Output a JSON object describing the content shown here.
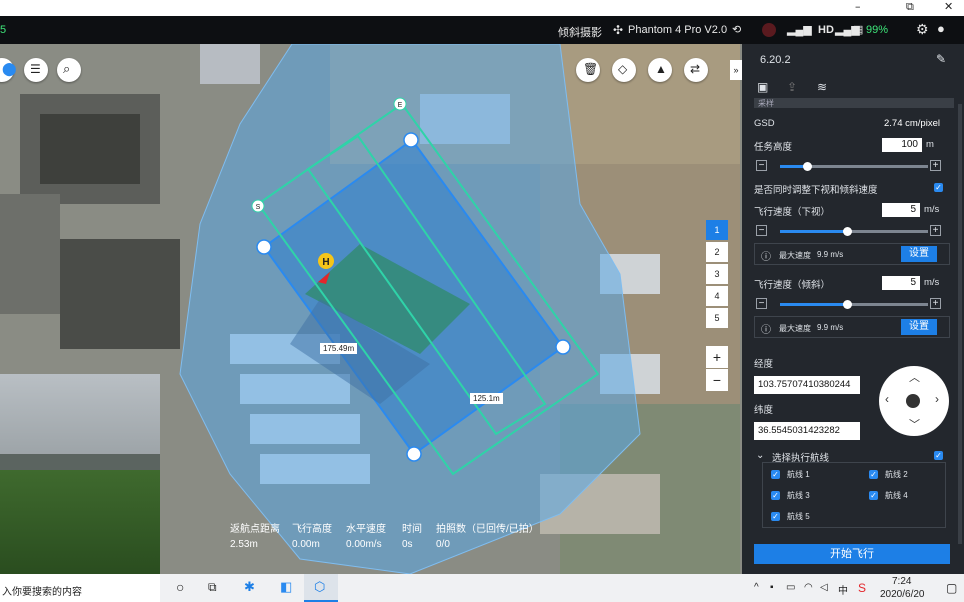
{
  "window": {
    "minimize": "–",
    "restore": "⧉",
    "close": "✕"
  },
  "status": {
    "left_mark": "5",
    "mode_label": "倾斜摄影",
    "drone_model": "Phantom 4 Pro V2.0",
    "hd_label": "HD",
    "battery": "99%"
  },
  "map": {
    "label_long": "175.49m",
    "label_short": "125.1m",
    "home_marker": "H",
    "start_marker": "S",
    "end_marker": "E",
    "route_tabs": [
      "1",
      "2",
      "3",
      "4",
      "5"
    ],
    "zoom_in": "+",
    "zoom_out": "−"
  },
  "telemetry": {
    "headers": [
      "返航点距离",
      "飞行高度",
      "水平速度",
      "时间",
      "拍照数（已回传/已拍）"
    ],
    "values": [
      "2.53m",
      "0.00m",
      "0.00m/s",
      "0s",
      "0/0"
    ]
  },
  "panel": {
    "version": "6.20.2",
    "partial_tab": "采样",
    "gsd_label": "GSD",
    "gsd_value": "2.74 cm/pixel",
    "altitude_label": "任务高度",
    "altitude_value": "100",
    "altitude_unit": "m",
    "altitude_level": 0.18,
    "simul_label": "是否同时调整下视和倾斜速度",
    "speed_down_label": "飞行速度（下视）",
    "speed_down_value": "5",
    "speed_unit": "m/s",
    "speed_down_level": 0.45,
    "max_speed_label": "最大速度",
    "max_speed_value": "9.9 m/s",
    "set_button": "设置",
    "speed_tilt_label": "飞行速度（倾斜）",
    "speed_tilt_value": "5",
    "speed_tilt_level": 0.45,
    "longitude_label": "经度",
    "longitude_value": "103.75707410380244",
    "latitude_label": "纬度",
    "latitude_value": "36.5545031423282",
    "select_routes_label": "选择执行航线",
    "routes": [
      "航线 1",
      "航线 2",
      "航线 3",
      "航线 4",
      "航线 5"
    ],
    "start_button": "开始飞行"
  },
  "taskbar": {
    "search_text": "入你要搜索的内容",
    "time": "7:24",
    "date": "2020/6/20"
  },
  "colors": {
    "accent": "#1d7fe6",
    "route": "#2fd3a8",
    "area": "#5aa7e6"
  }
}
